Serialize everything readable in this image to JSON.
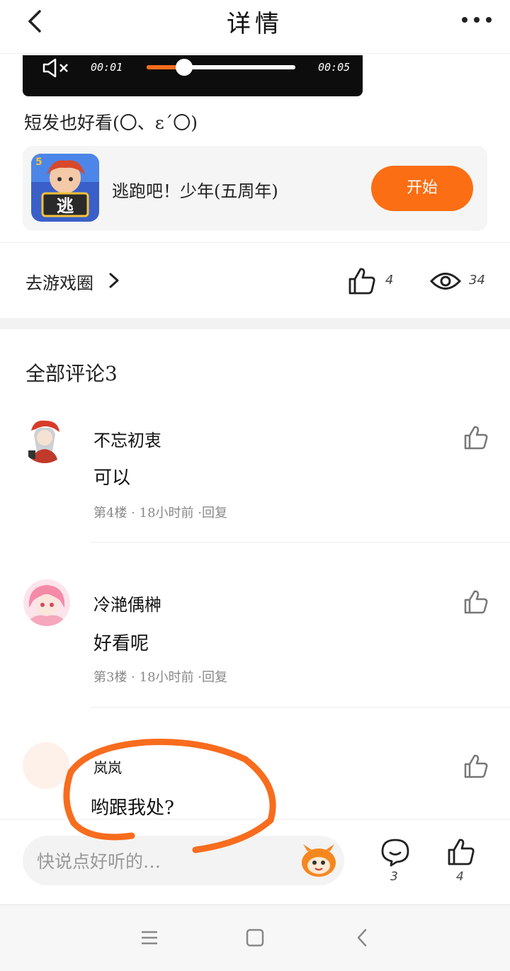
{
  "header": {
    "title": "详情"
  },
  "video": {
    "current_time": "00:01",
    "total_time": "00:05",
    "progress": 0.25
  },
  "post": {
    "text": "短发也好看(〇、ε´〇)"
  },
  "game": {
    "name": "逃跑吧！少年(五周年)",
    "start_label": "开始",
    "badge": "5",
    "icon_char": "逃"
  },
  "stats": {
    "goto_circle_label": "去游戏圈",
    "likes": "4",
    "views": "34"
  },
  "comments": {
    "header": "全部评论3",
    "items": [
      {
        "name": "不忘初衷",
        "text": "可以",
        "meta": "第4楼 · 18小时前 ·回复"
      },
      {
        "name": "冷滟偊榊",
        "text": "好看呢",
        "meta": "第3楼 · 18小时前 ·回复"
      },
      {
        "name": "岚岚",
        "text": "哟跟我处?",
        "meta": ""
      }
    ]
  },
  "bottom": {
    "input_placeholder": "快说点好听的…",
    "comment_count": "3",
    "like_count": "4"
  },
  "colors": {
    "accent": "#fb6e14",
    "annotation": "#f86c1d"
  }
}
